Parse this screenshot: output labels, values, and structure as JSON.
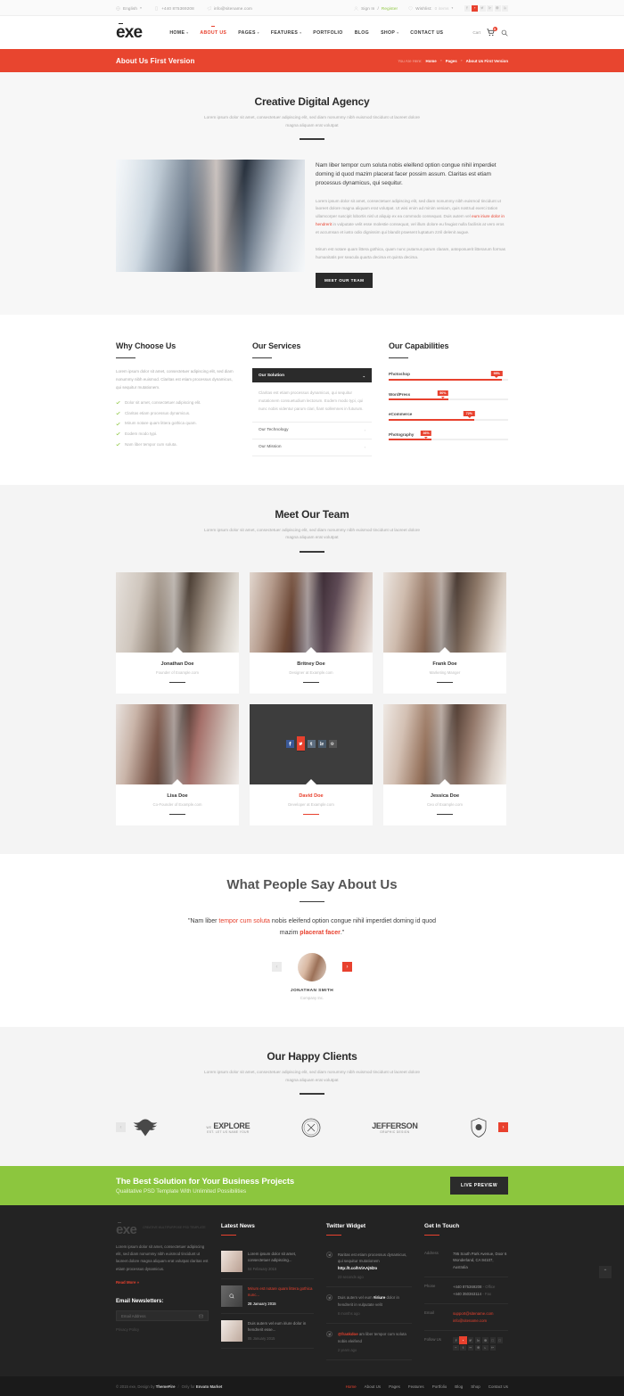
{
  "topbar": {
    "language": "English",
    "phone": "+440 875369208",
    "email": "info@sitename.com",
    "signin": "Sign In",
    "separator": "/",
    "register": "Register",
    "wishlist_label": "Wishlist:",
    "wishlist_value": "0 items",
    "socials": [
      "facebook-icon",
      "youtube-icon",
      "twitter-icon",
      "linkedin-icon",
      "pinterest-icon",
      "rss-icon"
    ]
  },
  "header": {
    "logo": "exe",
    "nav": [
      {
        "label": "HOME",
        "caret": true,
        "active": false
      },
      {
        "label": "ABOUT US",
        "caret": false,
        "active": true
      },
      {
        "label": "PAGES",
        "caret": true,
        "active": false
      },
      {
        "label": "FEATURES",
        "caret": true,
        "active": false
      },
      {
        "label": "PORTFOLIO",
        "caret": false,
        "active": false
      },
      {
        "label": "BLOG",
        "caret": false,
        "active": false
      },
      {
        "label": "SHOP",
        "caret": true,
        "active": false
      },
      {
        "label": "CONTACT US",
        "caret": false,
        "active": false
      }
    ],
    "cart_label": "Cart",
    "cart_count": "0"
  },
  "pagebar": {
    "title": "About Us First Version",
    "you_are_here": "You Are Here:",
    "crumbs": [
      "Home",
      "Pages",
      "About Us First Version"
    ]
  },
  "intro": {
    "title": "Creative Digital Agency",
    "subtitle": "Lorem ipsum dolor sit amet, consectetuer adipiscing elit, sed diam nonummy nibh euismod tincidunt ut laoreet dolore magna aliquam erat volutpat",
    "lead": "Nam liber tempor cum soluta nobis eleifend option congue nihil imperdiet doming id quod mazim placerat facer possim assum. Claritas est etiam processus dynamicus, qui sequitur.",
    "para1_a": "Lorem ipsum dolor sit amet, consectetuer adipiscing elit, sed diam nonummy nibh euismod tincidunt ut laoreet dolore magna aliquam erat volutpat. Ut wisi enim ad minim veniam, quis nostrud exerci tation ullamcorper suscipit lobortis nisl ut aliquip ex ea commodo consequat. Duis autem vel ",
    "para1_hl": "eum iriure dolor in hendrerit",
    "para1_b": " in vulputate velit esse molestie consequat, vel illum dolore eu feugiat nulla facilisis at vero eros et accumsan et iusto odio dignissim qui blandit praesent luptatum zzril delenit augue.",
    "para2": "Mirum est notare quam littera gothica, quam nunc putamus parum claram, anteposuerit litterarum formas humanitatis per seacula quarta decima et quinta decima.",
    "button": "MEET OUR TEAM"
  },
  "why": {
    "title": "Why Choose Us",
    "body": "Lorem ipsum dolor sit amet, consectetuer adipiscing elit, sed diam nonummy nibh euismod. Claritas est etiam processus dynamicus, qui sequitur mutationem.",
    "items": [
      "Dolor sit amet, consectetuer adipiscing elit.",
      "Claritas etiam processus dynamicus.",
      "Mirum notare quam littera gothica quam.",
      "Eodem modo typi.",
      "Nam liber tempor cum soluta."
    ]
  },
  "services": {
    "title": "Our Services",
    "open_label": "Our Solution",
    "open_body": "Claritas est etiam processus dynamicus, qui sequitur mutationem consuetudium lectorum. Eodem modo typi, qui nunc nobis videntur parum clari, fiant sollemnes in futurum.",
    "rows": [
      "Our Technology",
      "Our Mission"
    ]
  },
  "capabilities": {
    "title": "Our Capabilities",
    "skills": [
      {
        "name": "Photoshop",
        "pct": 95,
        "label": "95%"
      },
      {
        "name": "WordPress",
        "pct": 50,
        "label": "50%"
      },
      {
        "name": "eCommerce",
        "pct": 72,
        "label": "72%"
      },
      {
        "name": "Photography",
        "pct": 36,
        "label": "36%"
      }
    ]
  },
  "team": {
    "title": "Meet Our Team",
    "subtitle": "Lorem ipsum dolor sit amet, consectetuer adipiscing elit, sed diam nonummy nibh euismod tincidunt ut laoreet dolore magna aliquam erat volutpat",
    "members": [
      {
        "name": "Jonathan Doe",
        "role": "Founder of Example.com",
        "highlight": false
      },
      {
        "name": "Britney Doe",
        "role": "Designer at Example.com",
        "highlight": false
      },
      {
        "name": "Frank Doe",
        "role": "Marketing Manger",
        "highlight": false
      },
      {
        "name": "Lisa Doe",
        "role": "Co-Founder of Example.com",
        "highlight": false
      },
      {
        "name": "David Doe",
        "role": "Developer at Example.com",
        "highlight": true
      },
      {
        "name": "Jessica Doe",
        "role": "Ceo of Example.com",
        "highlight": false
      }
    ]
  },
  "testimonial": {
    "title": "What People Say About Us",
    "quote_a": "\"Nam liber ",
    "quote_hl": "tempor cum soluta",
    "quote_b": " nobis eleifend option congue nihil imperdiet doming id quod mazim ",
    "quote_bold": "placerat facer",
    "quote_c": ".\"",
    "author": "JONATHAN SMITH",
    "company": "Company Inc.",
    "prev": "‹",
    "next": "›"
  },
  "clients": {
    "title": "Our Happy Clients",
    "subtitle": "Lorem ipsum dolor sit amet, consectetuer adipiscing elit, sed diam nonummy nibh euismod tincidunt ut laoreet dolore magna aliquam erat volutpat",
    "logos": [
      {
        "type": "eagle",
        "main": "",
        "sub": ""
      },
      {
        "type": "text",
        "main": "EXPLORE",
        "sub": "EST. LET US NAME YOUR",
        "pre": "WE"
      },
      {
        "type": "circle",
        "main": "",
        "sub": ""
      },
      {
        "type": "text",
        "main": "JEFFERSON",
        "sub": "GRAPHIC DESIGN",
        "pre": ""
      },
      {
        "type": "shield",
        "main": "",
        "sub": ""
      }
    ],
    "prev": "‹",
    "next": "›"
  },
  "cta": {
    "title": "The Best Solution for Your Business Projects",
    "subtitle": "Qualitative PSD Template With Unlimited Possibilities",
    "button": "LIVE PREVIEW"
  },
  "footer": {
    "logo": "exe",
    "tagline": "CREATIVE MULTIPURPOSE PSD TEMPLATE",
    "about": "Lorem ipsum dolor sit amet, consectetuer adipiscing elit, sed diam nonummy nibh euismod tincidunt ut laoreet dolore magna aliquam erat volutpat claritas est etiam processus dynamicus.",
    "read_more": "Read More »",
    "newsletter_title": "Email Newsletters:",
    "newsletter_placeholder": "Email Address",
    "privacy": "Privacy Policy",
    "latest_news_title": "Latest News",
    "news": [
      {
        "text": "Lorem ipsum dolor sit amet, consectetuer adipiscing...",
        "date": "04 February 2015",
        "highlight": false
      },
      {
        "text": "Mirum est notare quam littera gothica nunc...",
        "date": "28 January 2015",
        "highlight": true
      },
      {
        "text": "Duis autem vel eum iriure dolor in hendrerit esse...",
        "date": "05 January 2015",
        "highlight": false
      }
    ],
    "twitter_title": "Twitter Widget",
    "tweets": [
      {
        "text": "Raritas est etiam processus dynamicus, qui sequitur mutationem ",
        "link": "http://t.co/hViAAj5l2o",
        "ago": "23 seconds ago"
      },
      {
        "text": "Duis autem vel eum ",
        "mention": "#iriure",
        "text2": " dolor in hendrerit in vulputate velit",
        "ago": "8 months ago"
      },
      {
        "handle": "@frankdoe",
        "text": " am liber tempor cum soluta nobis eleifend",
        "ago": "2 years ago"
      }
    ],
    "touch_title": "Get In Touch",
    "contact": [
      {
        "label": "Address",
        "value": "795 South Park Avenue, Door 6 Wonderland, CA 94107, Australia"
      },
      {
        "label": "Phone",
        "value": "+440 875369208",
        "suffix": "- Office",
        "value2": "+440 350363114",
        "suffix2": "- Fax"
      },
      {
        "label": "Email",
        "value": "support@sitename.com",
        "value2": "info@sitename.com"
      },
      {
        "label": "Follow Us",
        "value": ""
      }
    ],
    "to_top": "⌃"
  },
  "subfooter": {
    "copyright_a": "© 2015 exe, Design by ",
    "brand": "ThemeFire",
    "slash": "/",
    "copyright_b": "Only for ",
    "market": "Envato Market",
    "links": [
      {
        "label": "Home",
        "active": true
      },
      {
        "label": "About Us",
        "active": false
      },
      {
        "label": "Pages",
        "active": false
      },
      {
        "label": "Features",
        "active": false
      },
      {
        "label": "Portfolio",
        "active": false
      },
      {
        "label": "Blog",
        "active": false
      },
      {
        "label": "Shop",
        "active": false
      },
      {
        "label": "Contact Us",
        "active": false
      }
    ]
  }
}
